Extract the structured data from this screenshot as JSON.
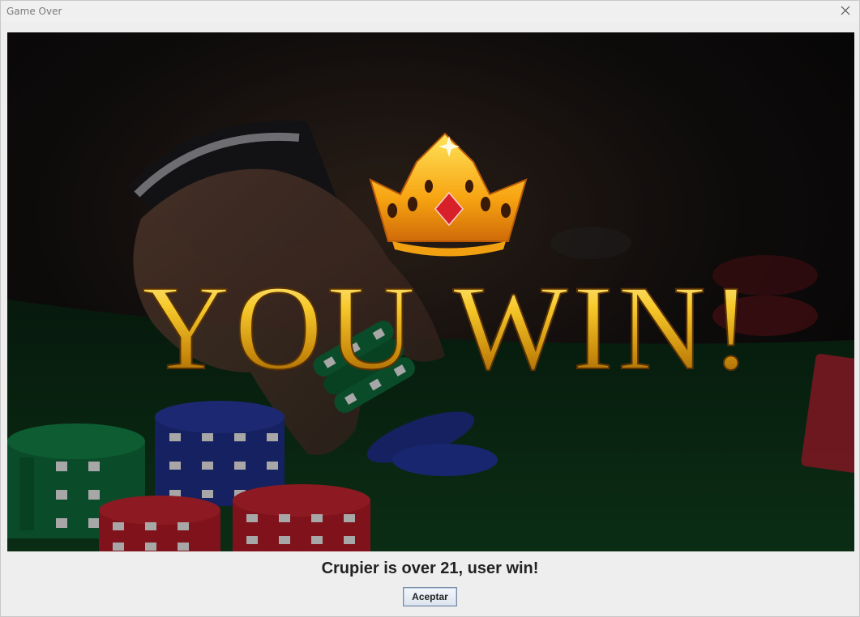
{
  "window": {
    "title": "Game Over"
  },
  "icons": {
    "close": "close-icon",
    "crown": "crown-icon"
  },
  "colors": {
    "gold": "#f2c21c",
    "felt": "#0d3a1a",
    "chip_red": "#b01a24",
    "chip_blue": "#1e2f86",
    "chip_green": "#0f6a3a"
  },
  "banner": {
    "headline": "YOU WIN!"
  },
  "dialog": {
    "message": "Crupier is over 21, user win!",
    "ok_label": "Aceptar"
  }
}
